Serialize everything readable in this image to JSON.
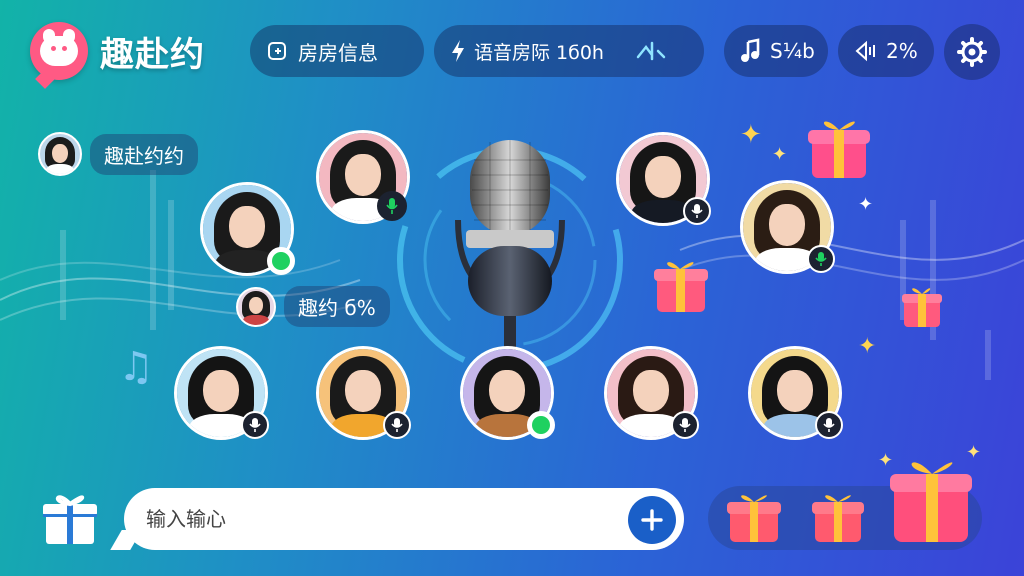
{
  "app": {
    "name": "趣赴约"
  },
  "topbar": {
    "room_info": "房房信息",
    "voice_room": "语音房际 1б0h",
    "music": "S¼b",
    "signal": "2%"
  },
  "chat": {
    "message": "趣赴约约"
  },
  "mid_chat": {
    "message": "趣约 б%"
  },
  "input": {
    "placeholder": "输入输心"
  },
  "colors": {
    "accent": "#1a5fc8",
    "brand": "#ff5a84",
    "speaking": "#1fd160"
  },
  "seats": [
    {
      "id": "seat-1",
      "status": "speaking"
    },
    {
      "id": "seat-2",
      "status": "mic"
    },
    {
      "id": "seat-3",
      "status": "mic"
    },
    {
      "id": "seat-4",
      "status": "mic"
    },
    {
      "id": "seat-5",
      "status": "mic"
    },
    {
      "id": "seat-6",
      "status": "mic"
    },
    {
      "id": "seat-7",
      "status": "speaking"
    },
    {
      "id": "seat-8",
      "status": "mic"
    },
    {
      "id": "seat-9",
      "status": "mic"
    }
  ]
}
